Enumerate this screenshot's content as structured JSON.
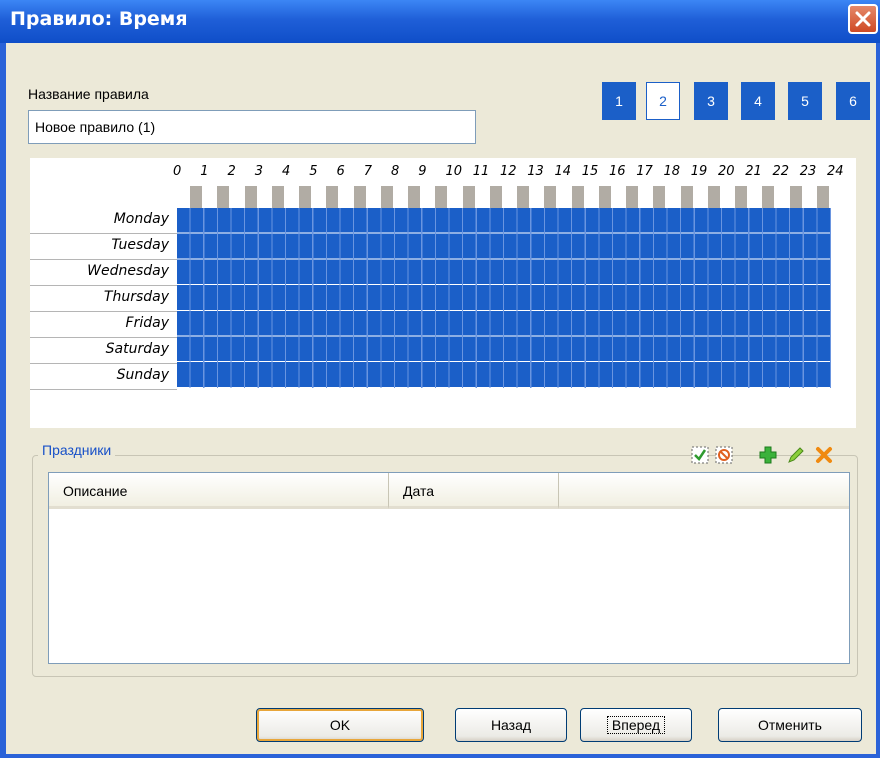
{
  "window": {
    "title": "Правило: Время"
  },
  "rule": {
    "name_label": "Название правила",
    "name_value": "Новое правило (1)"
  },
  "pages": {
    "items": [
      "1",
      "2",
      "3",
      "4",
      "5",
      "6"
    ],
    "active": "2"
  },
  "schedule": {
    "hours": [
      "0",
      "1",
      "2",
      "3",
      "4",
      "5",
      "6",
      "7",
      "8",
      "9",
      "10",
      "11",
      "12",
      "13",
      "14",
      "15",
      "16",
      "17",
      "18",
      "19",
      "20",
      "21",
      "22",
      "23",
      "24"
    ],
    "days": [
      "Monday",
      "Tuesday",
      "Wednesday",
      "Thursday",
      "Friday",
      "Saturday",
      "Sunday"
    ],
    "fill_color": "#1b5fc8",
    "selected_fraction": 1.0
  },
  "holidays": {
    "title": "Праздники",
    "columns": [
      "Описание",
      "Дата"
    ],
    "rows": [],
    "tools": [
      "check-all-icon",
      "uncheck-all-icon",
      "add-icon",
      "edit-icon",
      "delete-icon"
    ]
  },
  "buttons": {
    "ok": "OK",
    "back": "Назад",
    "next": "Вперед",
    "cancel": "Отменить"
  },
  "colors": {
    "title_bar": "#1f5fd8",
    "accent": "#1b5fc8",
    "group_title": "#1750c8"
  }
}
